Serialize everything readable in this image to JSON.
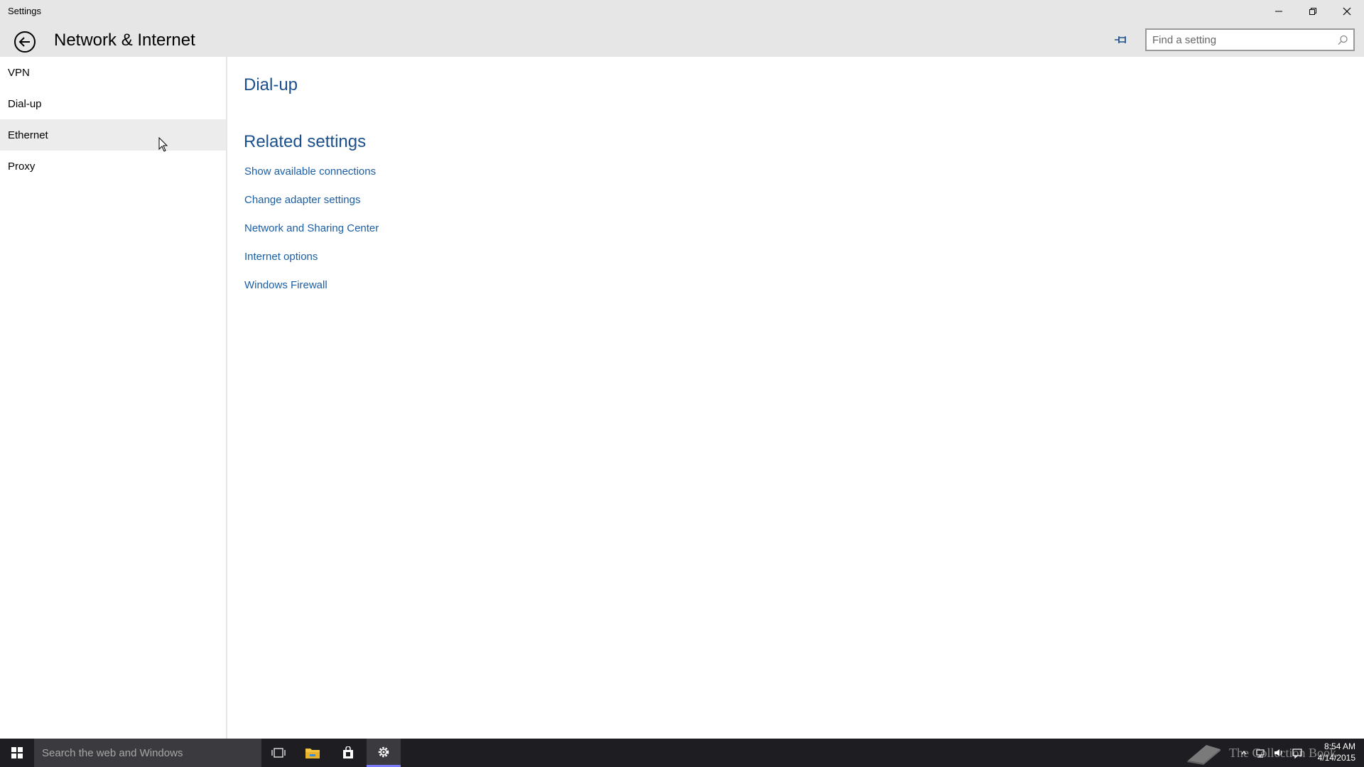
{
  "window": {
    "title": "Settings",
    "section_title": "Network & Internet"
  },
  "search": {
    "placeholder": "Find a setting"
  },
  "sidebar": {
    "items": [
      {
        "label": "VPN"
      },
      {
        "label": "Dial-up"
      },
      {
        "label": "Ethernet"
      },
      {
        "label": "Proxy"
      }
    ]
  },
  "main": {
    "heading": "Dial-up",
    "related_heading": "Related settings",
    "links": [
      {
        "label": "Show available connections"
      },
      {
        "label": "Change adapter settings"
      },
      {
        "label": "Network and Sharing Center"
      },
      {
        "label": "Internet options"
      },
      {
        "label": "Windows Firewall"
      }
    ]
  },
  "taskbar": {
    "search_placeholder": "Search the web and Windows",
    "watermark_text": "The Collection Book",
    "time": "8:54 AM",
    "date": "4/14/2015"
  },
  "colors": {
    "accent": "#1a4f8c",
    "link": "#1a5ea6",
    "titlebar_bg": "#e6e6e6",
    "taskbar_bg": "#1e1e22"
  }
}
